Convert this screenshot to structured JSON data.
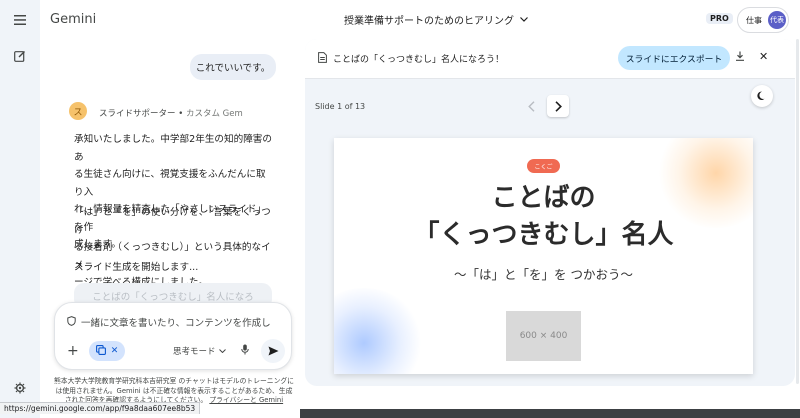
{
  "rail": {
    "icons": [
      "menu-icon",
      "new-chat-icon",
      "settings-icon"
    ]
  },
  "header": {
    "brand": "Gemini",
    "conversation_title": "授業準備サポートのためのヒアリング",
    "pro_badge": "PRO",
    "account_label": "仕事",
    "avatar_text": "代表"
  },
  "chat": {
    "user_message": "これでいいです。",
    "gem": {
      "avatar_letter": "ス",
      "name": "スライドサポーター",
      "type": "カスタム Gem"
    },
    "response_lines_1": [
      "承知いたしました。中学部2年生の知的障害のあ",
      "る生徒さん向けに、視覚支援をふんだんに取り入",
      "れ、情報量を精査した「やさしいスライド」を作",
      "成します。"
    ],
    "response_lines_2": [
      "「は」と「を」の使い分けを、「言葉をくっつけ",
      "る接着剤（くっつきむし）」という具体的なイメ",
      "ージで学べる構成にしました。"
    ],
    "response_line_3": "スライド生成を開始します...",
    "ghost_chip": "ことばの「くっつきむし」名人になろ"
  },
  "input": {
    "placeholder": "一緒に文章を書いたり、コンテンツを作成し",
    "mode_label": "思考モード"
  },
  "disclaimer": {
    "text": "熊本大学大学院教育学研究科本吉研究室 のチャットはモデルのトレーニングには使用されません。Gemini は不正確な情報を表示することがあるため、生成された回答を再確認するようにしてください。",
    "link": "プライバシーと Gemini"
  },
  "status_url": "https://gemini.google.com/app/f9a8daa607ee8b53",
  "canvas": {
    "title": "ことばの「くっつきむし」名人になろう！",
    "export_label": "スライドにエクスポート",
    "slide_counter": "Slide 1 of 13",
    "slide": {
      "badge": "こくご",
      "title_line1": "ことばの",
      "title_line2": "「くっつきむし」名人",
      "subtitle": "〜「は」と「を」を つかおう〜",
      "placeholder": "600 × 400"
    }
  },
  "colors": {
    "accent": "#0b57d0",
    "export_bg": "#c2e7ff",
    "badge": "#f06a52",
    "avatar": "#5b5fc7",
    "gem_avatar": "#f6c26b"
  }
}
